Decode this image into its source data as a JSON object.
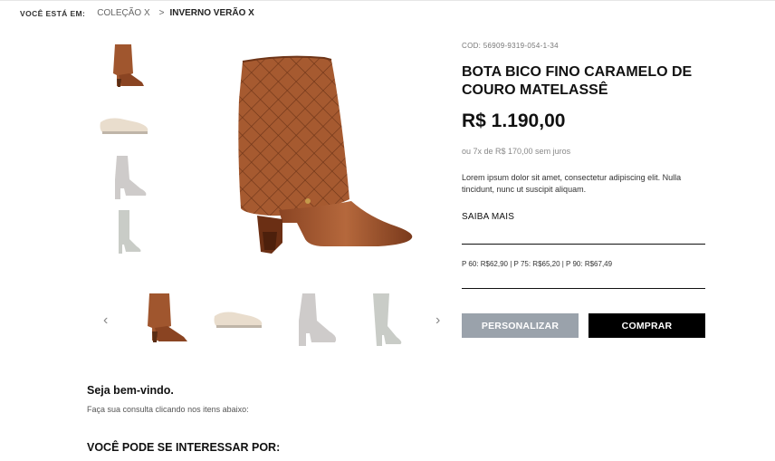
{
  "breadcrumb": {
    "label": "VOCÊ ESTÁ EM:",
    "items": [
      "COLEÇÃO X",
      "INVERNO VERÃO X"
    ],
    "separator": ">"
  },
  "product": {
    "sku": "COD: 56909-9319-054-1-34",
    "title": "BOTA BICO FINO CARAMELO DE COURO MATELASSÊ",
    "price": "R$ 1.190,00",
    "installments": "ou 7x de R$ 170,00 sem juros",
    "description": "Lorem ipsum dolor sit amet, consectetur adipiscing elit. Nulla tincidunt, nunc ut suscipit aliquam.",
    "more_link": "SAIBA MAIS",
    "size_prices": "P 60: R$62,90 | P 75: R$65,20 | P 90: R$67,49",
    "customize_button": "PERSONALIZAR",
    "buy_button": "COMPRAR"
  },
  "gallery": {
    "prev_icon": "chevron-left-icon",
    "next_icon": "chevron-right-icon",
    "colors": {
      "caramel": "#a0562e",
      "beige": "#d8c3a6",
      "grey": "#a7a29f"
    }
  },
  "welcome": {
    "title": "Seja bem-vindo.",
    "subtitle": "Faça sua consulta clicando nos itens abaixo:"
  },
  "suggestions": {
    "title": "VOCÊ PODE SE INTERESSAR POR:"
  }
}
